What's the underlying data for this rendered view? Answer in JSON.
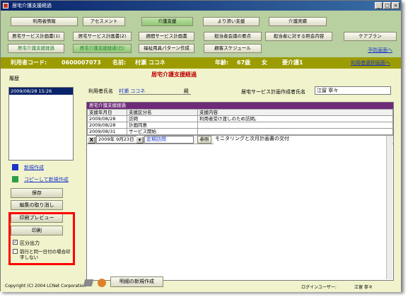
{
  "window": {
    "title": "居宅介護支援経過"
  },
  "nav_row1": [
    {
      "label": "利用者情報",
      "active": false
    },
    {
      "label": "アセスメント",
      "active": false
    },
    {
      "label": "介護支援",
      "active": true
    },
    {
      "label": "より添い支援",
      "active": false
    },
    {
      "label": "介護実績",
      "active": false
    }
  ],
  "nav_row2": [
    "居宅サービス計画書(1)",
    "居宅サービス計画書(2)",
    "週間サービス計画書",
    "担当者会議の要点",
    "担当者に対する照会内容",
    "ケアプラン"
  ],
  "nav_row3": [
    {
      "label": "居宅介護支援経過",
      "active": false
    },
    {
      "label": "居宅介護支援経過(日)",
      "active": true
    },
    {
      "label": "福祉用具パターン作成",
      "active": false
    },
    {
      "label": "顧客スケジュール",
      "active": false
    }
  ],
  "prev_screen_link": "予防画面へ",
  "user_select_link": "利用者選択画面へ",
  "info": {
    "user_code_label": "利用者コード:",
    "user_code": "0600007073",
    "name_label": "名前:",
    "name": "村瀬 ココネ",
    "age_label": "年齢:",
    "age": "67歳",
    "sex": "女",
    "care_level": "要介護1"
  },
  "history": {
    "label": "履歴",
    "items": [
      "2009/08/28 15:26"
    ]
  },
  "page_title": "居宅介護支援経過",
  "form": {
    "user_name_label": "利用者氏名",
    "user_name": "村瀬 ココネ",
    "honorific": "殿",
    "planner_label": "居宅サービス計画作成者氏名",
    "planner_name": "江留 寧々"
  },
  "sidebar": {
    "new_link": "新規作成",
    "copy_new_link": "コピーして新規作成",
    "save_label": "保存",
    "cancel_edit_label": "編集の取り消し",
    "print_preview_label": "印刷プレビュー",
    "print_label": "印刷",
    "section_output_label": "区分出力",
    "section_output_checked": true,
    "same_day_label": "前行と同一日付の場合印字しない",
    "same_day_checked": false
  },
  "record_table": {
    "title": "居宅介護支援経過",
    "columns": [
      "支援年月日",
      "支援区分名",
      "支援内容"
    ],
    "rows": [
      {
        "date": "2009/08/28",
        "category": "訪問",
        "content": "利用者受け渡しのため訪問。"
      },
      {
        "date": "2009/08/28",
        "category": "計画同意",
        "content": ""
      },
      {
        "date": "2009/08/31",
        "category": "サービス開始",
        "content": ""
      }
    ],
    "edit_row": {
      "delete_mark": "X",
      "date_value": "2009年 9月23日",
      "category_value": "定期訪問",
      "ref_button": "参照",
      "content_value": "モニタリングと次月計画書の交付"
    }
  },
  "footer": {
    "copyright": "Copyright (C) 2004 LCNet Corporation",
    "new_detail_label": "明細の新規作成",
    "login_user_label": "ログインユーザー:",
    "login_user": "江留 寧々"
  },
  "colors": {
    "title_bar": "#0a246a",
    "info_bar": "#9c9c00",
    "highlight_box": "#ff0000",
    "panel_header": "#6f2a7a"
  }
}
